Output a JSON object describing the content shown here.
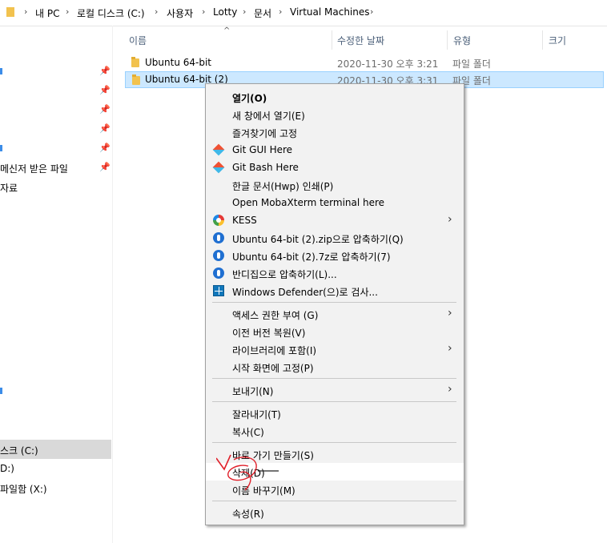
{
  "breadcrumb": [
    "내 PC",
    "로컬 디스크 (C:)",
    "사용자",
    "Lotty",
    "문서",
    "Virtual Machines"
  ],
  "nav": {
    "items": [
      "메신저 받은 파일",
      "자료",
      "스크 (C:)",
      "D:)",
      "파일함 (X:)"
    ]
  },
  "columns": {
    "name": "이름",
    "modified": "수정한 날짜",
    "type": "유형",
    "size": "크기"
  },
  "files": [
    {
      "name": "Ubuntu 64-bit",
      "modified": "2020-11-30 오후 3:21",
      "type": "파일 폴더"
    },
    {
      "name": "Ubuntu 64-bit (2)",
      "modified": "2020-11-30 오후 3:31",
      "type": "파일 폴더"
    }
  ],
  "menu": {
    "open": "열기(O)",
    "open_new_window": "새 창에서 열기(E)",
    "pin_quick": "즐겨찾기에 고정",
    "git_gui": "Git GUI Here",
    "git_bash": "Git Bash Here",
    "hwp_print": "한글 문서(Hwp) 인쇄(P)",
    "moba": "Open MobaXterm terminal here",
    "kess": "KESS",
    "zip": "Ubuntu 64-bit (2).zip으로 압축하기(Q)",
    "sevenz": "Ubuntu 64-bit (2).7z로 압축하기(7)",
    "bandizip": "반디집으로 압축하기(L)...",
    "defender": "Windows Defender(으)로 검사...",
    "access": "액세스 권한 부여 (G)",
    "restore": "이전 버전 복원(V)",
    "library": "라이브러리에 포함(I)",
    "pin_start": "시작 화면에 고정(P)",
    "send_to": "보내기(N)",
    "cut": "잘라내기(T)",
    "copy": "복사(C)",
    "shortcut": "바로 가기 만들기(S)",
    "delete": "삭제(D)",
    "rename": "이름 바꾸기(M)",
    "properties": "속성(R)"
  },
  "icons": {
    "pin": "pin-icon",
    "chevron": "chevron-right-icon",
    "sort": "sort-up-icon"
  }
}
